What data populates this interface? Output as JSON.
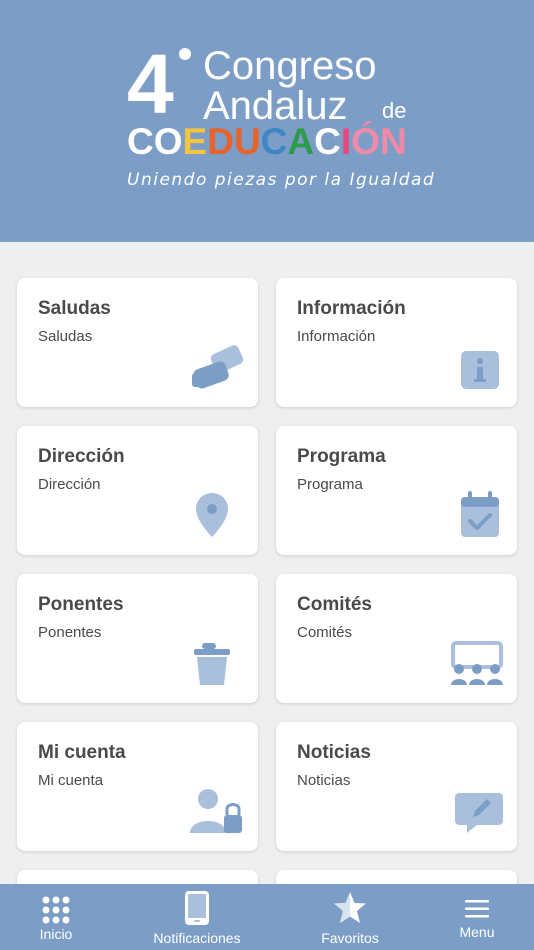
{
  "header": {
    "logo_number": "4",
    "logo_line1": "Congreso",
    "logo_line2": "Andaluz",
    "logo_de": "de",
    "logo_coeducacion_letters": [
      {
        "char": "C",
        "color": "#ffffff"
      },
      {
        "char": "O",
        "color": "#ffffff"
      },
      {
        "char": "E",
        "color": "#f4c542"
      },
      {
        "char": "D",
        "color": "#e8622a"
      },
      {
        "char": "U",
        "color": "#e8622a"
      },
      {
        "char": "C",
        "color": "#3f86c8"
      },
      {
        "char": "A",
        "color": "#2e9a4b"
      },
      {
        "char": "C",
        "color": "#ffffff"
      },
      {
        "char": "I",
        "color": "#e8467c"
      },
      {
        "char": "Ó",
        "color": "#f08aa8"
      },
      {
        "char": "N",
        "color": "#f08aa8"
      }
    ],
    "tagline": "Uniendo piezas por la Igualdad"
  },
  "cards": [
    {
      "title": "Saludas",
      "subtitle": "Saludas",
      "icon": "handshake-icon"
    },
    {
      "title": "Información",
      "subtitle": "Información",
      "icon": "info-icon"
    },
    {
      "title": "Dirección",
      "subtitle": "Dirección",
      "icon": "map-pin-icon"
    },
    {
      "title": "Programa",
      "subtitle": "Programa",
      "icon": "calendar-check-icon"
    },
    {
      "title": "Ponentes",
      "subtitle": "Ponentes",
      "icon": "podium-icon"
    },
    {
      "title": "Comités",
      "subtitle": "Comités",
      "icon": "committee-icon"
    },
    {
      "title": "Mi cuenta",
      "subtitle": "Mi cuenta",
      "icon": "user-lock-icon"
    },
    {
      "title": "Noticias",
      "subtitle": "Noticias",
      "icon": "comment-edit-icon"
    }
  ],
  "tabbar": {
    "inicio": "Inicio",
    "notificaciones": "Notificaciones",
    "favoritos": "Favoritos",
    "menu": "Menu"
  },
  "colors": {
    "primary": "#7c9dc6",
    "icon": "#a9bfdc",
    "icon_dark": "#7c9dc6"
  }
}
